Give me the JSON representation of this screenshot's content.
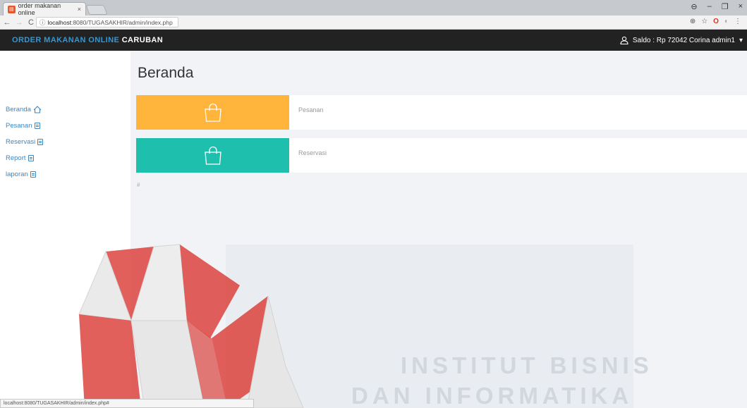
{
  "browser": {
    "tab_title": "order makanan online",
    "tab_close": "×",
    "url_host": "localhost",
    "url_rest": ":8080/TUGASAKHIR/admin/index.php",
    "status_url": "localhost:8080/TUGASAKHIR/admin/index.php#",
    "window_controls": [
      "⊖",
      "–",
      "❐",
      "×"
    ],
    "toolbar_icons": [
      "zoom-icon",
      "star-icon",
      "opera-icon",
      "extension-icon",
      "menu-icon"
    ]
  },
  "navbar": {
    "brand_part1": "ORDER MAKANAN ONLINE",
    "brand_part2": "CARUBAN",
    "user_text": "Saldo : Rp 72042 Corina admin1",
    "caret": "▾"
  },
  "sidebar": {
    "items": [
      {
        "label": "Beranda",
        "icon": "home-icon"
      },
      {
        "label": "Pesanan",
        "icon": "document-icon"
      },
      {
        "label": "Reservasi",
        "icon": "document-icon"
      },
      {
        "label": "Report",
        "icon": "document-icon"
      },
      {
        "label": "laporan",
        "icon": "document-icon"
      }
    ]
  },
  "main": {
    "title": "Beranda",
    "panels": [
      {
        "label": "Pesanan",
        "color": "#ffb43c",
        "icon": "shopping-bag-icon"
      },
      {
        "label": "Reservasi",
        "color": "#1fbfae",
        "icon": "shopping-bag-icon"
      }
    ],
    "footer_hash": "#"
  },
  "watermark": {
    "line1": "INSTITUT BISNIS",
    "line2": "DAN INFORMATIKA",
    "colors": [
      "#e0301e",
      "#d9d9d9"
    ]
  }
}
